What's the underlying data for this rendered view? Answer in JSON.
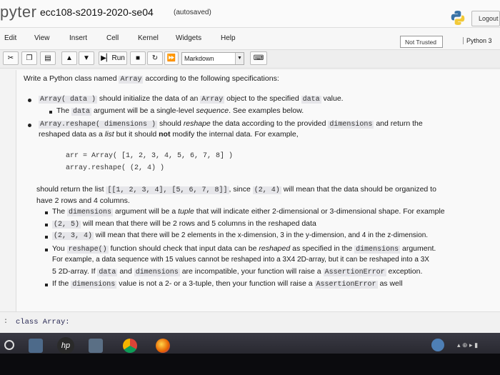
{
  "header": {
    "brand": "pyter",
    "notebook_name": "ecc108-s2019-2020-se04",
    "autosave_status": "(autosaved)",
    "logout_label": "Logout"
  },
  "menubar": {
    "items": [
      "Edit",
      "View",
      "Insert",
      "Cell",
      "Kernel",
      "Widgets",
      "Help"
    ],
    "trust_label": "Not Trusted",
    "kernel_label": "Python 3"
  },
  "toolbar": {
    "run_label": "Run",
    "cell_type": "Markdown"
  },
  "markdown": {
    "intro_a": "Write a Python class named ",
    "intro_code": "Array",
    "intro_b": " according to the following specifications:",
    "b1_code": "Array( data )",
    "b1_a": " should initialize the data of an ",
    "b1_code2": "Array",
    "b1_b": " object to the specified ",
    "b1_code3": "data",
    "b1_c": " value.",
    "b1s_a": "The ",
    "b1s_code": "data",
    "b1s_b": " argument will be a single-level ",
    "b1s_em": "sequence",
    "b1s_c": ". See examples below.",
    "b2_code": "Array.reshape( dimensions )",
    "b2_a": " should ",
    "b2_em": "reshape",
    "b2_b": " the data according to the provided ",
    "b2_code2": "dimensions",
    "b2_c": " and return the",
    "b2_l2_a": "reshaped data as a ",
    "b2_l2_em": "list",
    "b2_l2_b": " but it should ",
    "b2_l2_strong": "not",
    "b2_l2_c": " modify the internal data. For example,",
    "example_line1": "arr = Array( [1, 2, 3, 4, 5, 6, 7, 8] )",
    "example_line2": "array.reshape( (2, 4) )",
    "ret_a": "should return the list ",
    "ret_code": "[[1, 2, 3, 4], [5, 6, 7, 8]]",
    "ret_b": ", since ",
    "ret_code2": "(2, 4)",
    "ret_c": " will mean that the data should be organized to",
    "ret_l2": "have 2 rows and 4 columns.",
    "s1_a": "The ",
    "s1_code": "dimensions",
    "s1_b": " argument will be a ",
    "s1_em": "tuple",
    "s1_c": " that will indicate either 2-dimensional or 3-dimensional shape. For example",
    "s2_code": "(2, 5)",
    "s2_a": " will mean that there will be 2 rows and 5 columns in the reshaped data",
    "s3_code": "(2, 3, 4)",
    "s3_a": " will mean that there will be 2 elements in the x-dimension, 3 in the y-dimension, and 4 in the z-dimension.",
    "s4_a": "You ",
    "s4_code": "reshape()",
    "s4_b": " function should check that input data can be ",
    "s4_em": "reshaped",
    "s4_c": " as specified in the ",
    "s4_code2": "dimensions",
    "s4_d": " argument.",
    "s4_l2": "For example, a data sequence with 15 values cannot be reshaped into a 3X4 2D-array, but it can be reshaped into a 3X",
    "s4_l3_a": "5 2D-array. If ",
    "s4_l3_code": "data",
    "s4_l3_b": " and ",
    "s4_l3_code2": "dimensions",
    "s4_l3_c": " are incompatible, your function will raise a ",
    "s4_l3_code3": "AssertionError",
    "s4_l3_d": " exception.",
    "s5_a": "If the ",
    "s5_code": "dimensions",
    "s5_b": " value is not a 2- or a 3-tuple, then your function will raise a ",
    "s5_code2": "AssertionError",
    "s5_c": " as well"
  },
  "code_cell": {
    "prompt": ":",
    "source": "class Array:"
  },
  "colors": {
    "code_bg": "#e6e6ea",
    "taskbar": "#17171c"
  },
  "icons": [
    "python-logo-icon",
    "cut-icon",
    "copy-icon",
    "paste-icon",
    "arrow-up-icon",
    "arrow-down-icon",
    "run-icon",
    "stop-icon",
    "restart-icon",
    "fast-forward-icon",
    "keyboard-icon",
    "chrome-icon",
    "firefox-icon",
    "hp-icon"
  ]
}
